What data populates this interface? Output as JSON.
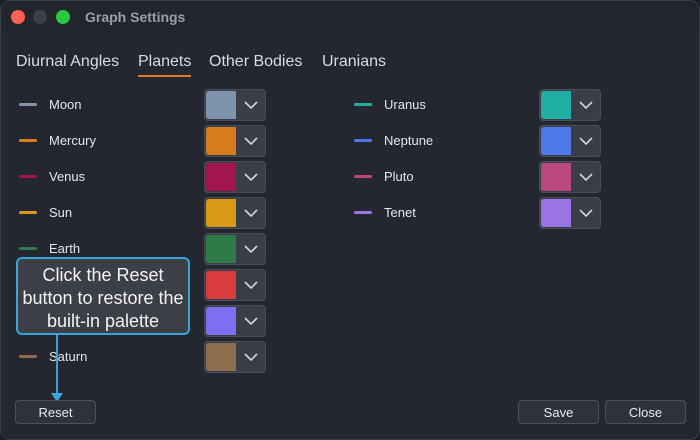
{
  "window": {
    "title": "Graph Settings"
  },
  "tabs": [
    {
      "label": "Diurnal Angles"
    },
    {
      "label": "Planets",
      "active": true
    },
    {
      "label": "Other Bodies"
    },
    {
      "label": "Uranians"
    }
  ],
  "left_column": [
    {
      "name": "Moon",
      "color": "#7f93ad"
    },
    {
      "name": "Mercury",
      "color": "#d57d1e"
    },
    {
      "name": "Venus",
      "color": "#a3154d"
    },
    {
      "name": "Sun",
      "color": "#d99a15"
    },
    {
      "name": "Earth",
      "color": "#2f7b47"
    },
    {
      "name": "",
      "color": "#d93c3c"
    },
    {
      "name": "",
      "color": "#7f6ef0"
    },
    {
      "name": "Saturn",
      "color": "#8c6d4d"
    }
  ],
  "right_column": [
    {
      "name": "Uranus",
      "color": "#1fb0a3"
    },
    {
      "name": "Neptune",
      "color": "#4d79e8"
    },
    {
      "name": "Pluto",
      "color": "#b8487d"
    },
    {
      "name": "Tenet",
      "color": "#9a74e3"
    }
  ],
  "buttons": {
    "reset": "Reset",
    "save": "Save",
    "close": "Close"
  },
  "callout": {
    "text": "Click the Reset button to restore the built-in palette"
  },
  "colors": {
    "accent_tab": "#e07a2e",
    "callout_border": "#3aa4d8"
  }
}
